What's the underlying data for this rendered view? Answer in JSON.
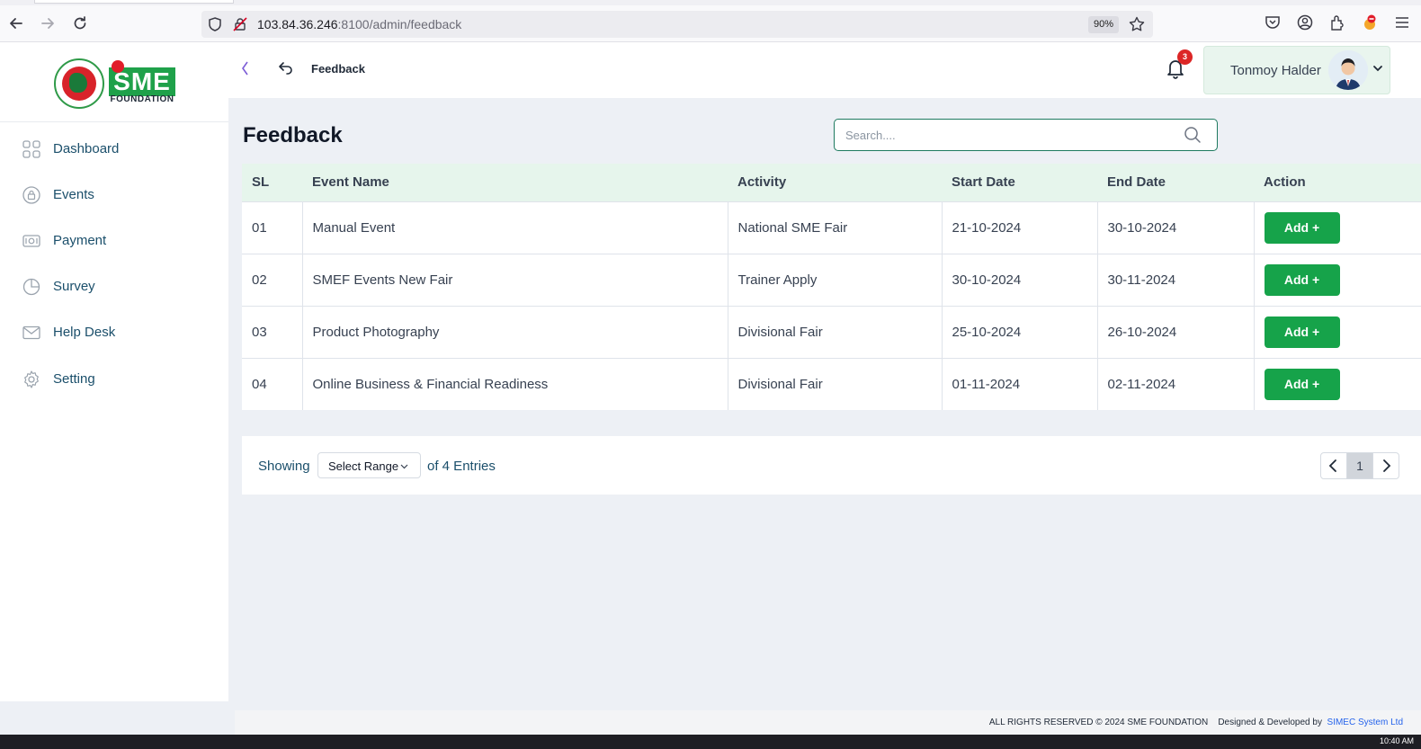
{
  "browser": {
    "url_host": "103.84.36.246",
    "url_rest": ":8100/admin/feedback",
    "zoom": "90%"
  },
  "sidebar": {
    "logo_text": "SME",
    "logo_sub": "FOUNDATION",
    "items": [
      {
        "label": "Dashboard",
        "icon": "grid-icon"
      },
      {
        "label": "Events",
        "icon": "lock-icon"
      },
      {
        "label": "Payment",
        "icon": "cash-icon"
      },
      {
        "label": "Survey",
        "icon": "pie-icon"
      },
      {
        "label": "Help Desk",
        "icon": "mail-icon"
      },
      {
        "label": "Setting",
        "icon": "gear-icon"
      }
    ]
  },
  "header": {
    "crumb": "Feedback",
    "notification_count": "3",
    "user_name": "Tonmoy Halder"
  },
  "main": {
    "title": "Feedback",
    "search_placeholder": "Search....",
    "columns": [
      "SL",
      "Event Name",
      "Activity",
      "Start Date",
      "End Date",
      "Action"
    ],
    "rows": [
      {
        "sl": "01",
        "event": "Manual Event",
        "activity": "National SME Fair",
        "start": "21-10-2024",
        "end": "30-10-2024",
        "action": "Add +"
      },
      {
        "sl": "02",
        "event": "SMEF Events New Fair",
        "activity": "Trainer Apply",
        "start": "30-10-2024",
        "end": "30-11-2024",
        "action": "Add +"
      },
      {
        "sl": "03",
        "event": "Product Photography",
        "activity": "Divisional Fair",
        "start": "25-10-2024",
        "end": "26-10-2024",
        "action": "Add +"
      },
      {
        "sl": "04",
        "event": "Online Business & Financial Readiness",
        "activity": "Divisional Fair",
        "start": "01-11-2024",
        "end": "02-11-2024",
        "action": "Add +"
      }
    ]
  },
  "pagination": {
    "showing": "Showing",
    "range": "Select Range",
    "entries": "of 4 Entries",
    "page": "1"
  },
  "footer": {
    "rights": "ALL RIGHTS RESERVED © 2024 SME FOUNDATION",
    "designed": "Designed & Developed by",
    "company": "SIMEC System Ltd"
  },
  "taskbar": {
    "clock": "10:40 AM"
  },
  "colors": {
    "primary_green": "#16a34a",
    "nav_text": "#1b4f6b",
    "header_green_bg": "#e6f5ec"
  }
}
